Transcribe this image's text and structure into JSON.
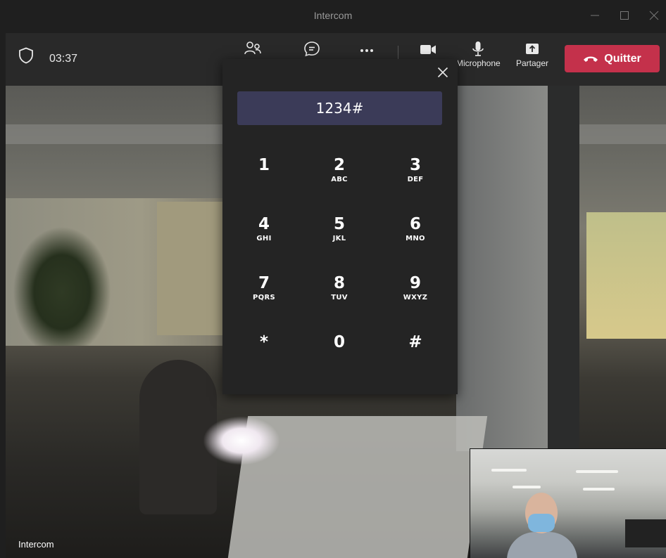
{
  "window": {
    "title": "Intercom"
  },
  "call": {
    "timer": "03:37",
    "toolbar": {
      "microphone_label": "Microphone",
      "share_label": "Partager",
      "leave_label": "Quitter"
    }
  },
  "dialpad": {
    "display_value": "1234#",
    "keys": [
      {
        "digit": "1",
        "letters": ""
      },
      {
        "digit": "2",
        "letters": "ABC"
      },
      {
        "digit": "3",
        "letters": "DEF"
      },
      {
        "digit": "4",
        "letters": "GHI"
      },
      {
        "digit": "5",
        "letters": "JKL"
      },
      {
        "digit": "6",
        "letters": "MNO"
      },
      {
        "digit": "7",
        "letters": "PQRS"
      },
      {
        "digit": "8",
        "letters": "TUV"
      },
      {
        "digit": "9",
        "letters": "WXYZ"
      },
      {
        "digit": "*",
        "letters": ""
      },
      {
        "digit": "0",
        "letters": ""
      },
      {
        "digit": "#",
        "letters": ""
      }
    ]
  },
  "video": {
    "participant_label": "Intercom"
  },
  "colors": {
    "leave": "#c4314b",
    "display": "#3b3b58",
    "panel": "#242424"
  }
}
